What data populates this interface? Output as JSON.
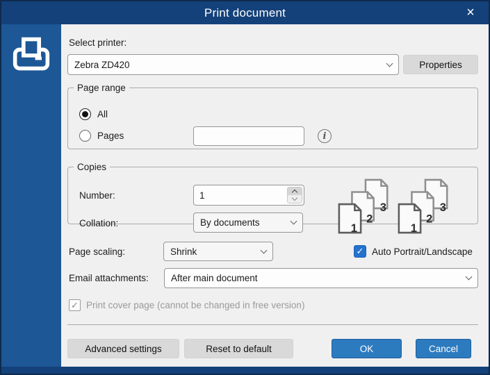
{
  "window": {
    "title": "Print document"
  },
  "icons": {
    "close": "×",
    "check": "✓",
    "info": "i",
    "printer": "printer-icon",
    "collation": "collated-pages-icon"
  },
  "colors": {
    "title_bar": "#14417A",
    "sidebar": "#1D5795",
    "accent_button": "#2D7BBF",
    "checkbox_accent": "#2472CE"
  },
  "printer": {
    "label": "Select printer:",
    "value": "Zebra ZD420",
    "properties": "Properties"
  },
  "page_range": {
    "legend": "Page range",
    "all": "All",
    "all_selected": true,
    "pages": "Pages",
    "pages_value": ""
  },
  "copies": {
    "legend": "Copies",
    "number_label": "Number:",
    "number_value": "1",
    "collation_label": "Collation:",
    "collation_value": "By documents",
    "icon_numbers": [
      "1",
      "2",
      "3"
    ]
  },
  "scaling": {
    "label": "Page scaling:",
    "value": "Shrink"
  },
  "auto_orientation": {
    "label": "Auto Portrait/Landscape",
    "checked": true
  },
  "email": {
    "label": "Email attachments:",
    "value": "After main document"
  },
  "cover_page": {
    "label": "Print cover page (cannot be changed in free version)",
    "checked": true,
    "disabled": true
  },
  "footer": {
    "advanced": "Advanced settings",
    "reset": "Reset to default",
    "ok": "OK",
    "cancel": "Cancel"
  }
}
